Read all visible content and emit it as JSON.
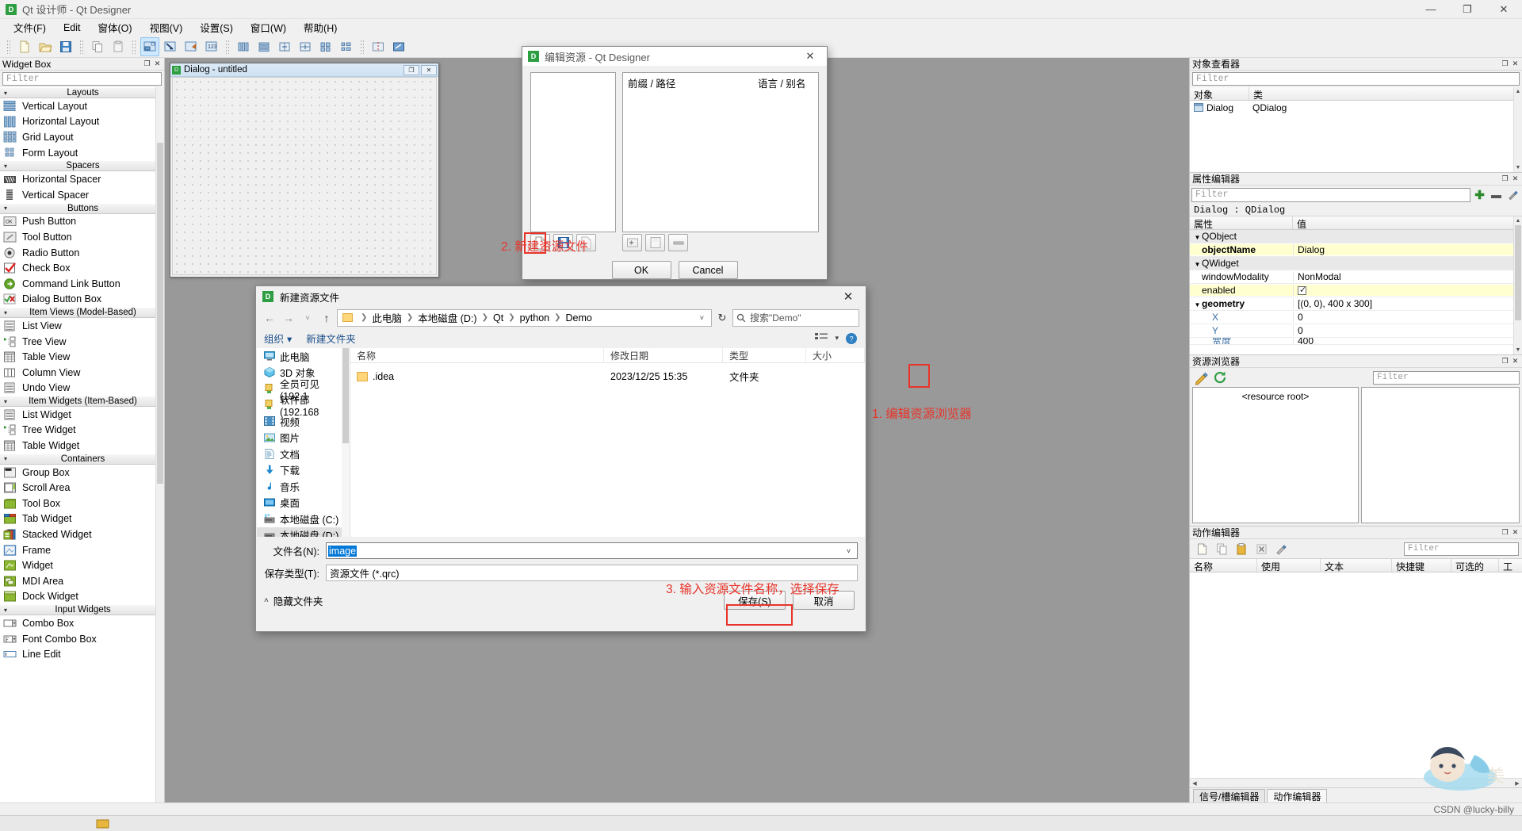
{
  "window": {
    "app_icon": "qt-designer-icon",
    "title": "Qt 设计师 - Qt Designer",
    "minimize": "—",
    "maximize": "❐",
    "close": "✕"
  },
  "menubar": {
    "items": [
      {
        "label": "文件(F)"
      },
      {
        "label": "Edit"
      },
      {
        "label": "窗体(O)"
      },
      {
        "label": "视图(V)"
      },
      {
        "label": "设置(S)"
      },
      {
        "label": "窗口(W)"
      },
      {
        "label": "帮助(H)"
      }
    ]
  },
  "toolbar": {
    "buttons": [
      {
        "name": "new-form-button",
        "icon": "page-icon"
      },
      {
        "name": "open-form-button",
        "icon": "folder-open-icon"
      },
      {
        "name": "save-form-button",
        "icon": "floppy-save-icon"
      },
      {
        "name": "copy-button",
        "icon": "copy-icon"
      },
      {
        "name": "paste-button",
        "icon": "paste-icon"
      },
      {
        "name": "edit-widgets-button",
        "icon": "edit-widgets-icon",
        "active": true
      },
      {
        "name": "edit-signals-slots-button",
        "icon": "signal-slot-icon"
      },
      {
        "name": "edit-buddies-button",
        "icon": "buddies-icon"
      },
      {
        "name": "edit-tab-order-button",
        "icon": "tab-order-icon"
      },
      {
        "name": "layout-horizontal-button",
        "icon": "layout-h-icon"
      },
      {
        "name": "layout-vertical-button",
        "icon": "layout-v-icon"
      },
      {
        "name": "layout-splitter-h-button",
        "icon": "splitter-h-icon"
      },
      {
        "name": "layout-splitter-v-button",
        "icon": "splitter-v-icon"
      },
      {
        "name": "layout-grid-button",
        "icon": "layout-grid-icon"
      },
      {
        "name": "layout-form-button",
        "icon": "layout-form-icon"
      },
      {
        "name": "break-layout-button",
        "icon": "break-layout-icon"
      },
      {
        "name": "adjust-size-button",
        "icon": "adjust-size-icon"
      }
    ]
  },
  "widget_box": {
    "title": "Widget Box",
    "float_btn": "❐",
    "close_btn": "✕",
    "filter_placeholder": "Filter",
    "groups": [
      {
        "label": "Layouts",
        "items": [
          {
            "label": "Vertical Layout",
            "icon": "vertical-layout-icon"
          },
          {
            "label": "Horizontal Layout",
            "icon": "horizontal-layout-icon"
          },
          {
            "label": "Grid Layout",
            "icon": "grid-layout-icon"
          },
          {
            "label": "Form Layout",
            "icon": "form-layout-icon"
          }
        ]
      },
      {
        "label": "Spacers",
        "items": [
          {
            "label": "Horizontal Spacer",
            "icon": "horizontal-spacer-icon"
          },
          {
            "label": "Vertical Spacer",
            "icon": "vertical-spacer-icon"
          }
        ]
      },
      {
        "label": "Buttons",
        "items": [
          {
            "label": "Push Button",
            "icon": "push-button-icon"
          },
          {
            "label": "Tool Button",
            "icon": "tool-button-icon"
          },
          {
            "label": "Radio Button",
            "icon": "radio-button-icon"
          },
          {
            "label": "Check Box",
            "icon": "check-box-icon"
          },
          {
            "label": "Command Link Button",
            "icon": "command-link-icon"
          },
          {
            "label": "Dialog Button Box",
            "icon": "dialog-button-box-icon"
          }
        ]
      },
      {
        "label": "Item Views (Model-Based)",
        "items": [
          {
            "label": "List View",
            "icon": "list-view-icon"
          },
          {
            "label": "Tree View",
            "icon": "tree-view-icon"
          },
          {
            "label": "Table View",
            "icon": "table-view-icon"
          },
          {
            "label": "Column View",
            "icon": "column-view-icon"
          },
          {
            "label": "Undo View",
            "icon": "undo-view-icon"
          }
        ]
      },
      {
        "label": "Item Widgets (Item-Based)",
        "items": [
          {
            "label": "List Widget",
            "icon": "list-widget-icon"
          },
          {
            "label": "Tree Widget",
            "icon": "tree-widget-icon"
          },
          {
            "label": "Table Widget",
            "icon": "table-widget-icon"
          }
        ]
      },
      {
        "label": "Containers",
        "items": [
          {
            "label": "Group Box",
            "icon": "group-box-icon"
          },
          {
            "label": "Scroll Area",
            "icon": "scroll-area-icon"
          },
          {
            "label": "Tool Box",
            "icon": "tool-box-icon"
          },
          {
            "label": "Tab Widget",
            "icon": "tab-widget-icon"
          },
          {
            "label": "Stacked Widget",
            "icon": "stacked-widget-icon"
          },
          {
            "label": "Frame",
            "icon": "frame-icon"
          },
          {
            "label": "Widget",
            "icon": "widget-icon"
          },
          {
            "label": "MDI Area",
            "icon": "mdi-area-icon"
          },
          {
            "label": "Dock Widget",
            "icon": "dock-widget-icon"
          }
        ]
      },
      {
        "label": "Input Widgets",
        "items": [
          {
            "label": "Combo Box",
            "icon": "combo-box-icon"
          },
          {
            "label": "Font Combo Box",
            "icon": "font-combo-box-icon"
          },
          {
            "label": "Line Edit",
            "icon": "line-edit-icon"
          }
        ]
      }
    ]
  },
  "form_window": {
    "icon": "qt-designer-icon",
    "title": "Dialog - untitled",
    "restore_btn": "❐",
    "close_btn": "✕"
  },
  "object_inspector": {
    "title": "对象查看器",
    "float_btn": "❐",
    "close_btn": "✕",
    "filter_placeholder": "Filter",
    "columns": [
      "对象",
      "类"
    ],
    "rows": [
      {
        "object": "Dialog",
        "class": "QDialog",
        "icon": "dialog-icon"
      }
    ]
  },
  "property_editor": {
    "title": "属性编辑器",
    "float_btn": "❐",
    "close_btn": "✕",
    "filter_placeholder": "Filter",
    "add_btn": "✚",
    "remove_btn": "➖",
    "config_btn": "wrench-icon",
    "object_label": "Dialog : QDialog",
    "columns": [
      "属性",
      "值"
    ],
    "rows": [
      {
        "kind": "group",
        "name": "QObject",
        "value": "",
        "twisty": "▼"
      },
      {
        "kind": "prop",
        "name": "objectName",
        "value": "Dialog",
        "bold": true,
        "highlight": true
      },
      {
        "kind": "group",
        "name": "QWidget",
        "value": "",
        "twisty": "▼"
      },
      {
        "kind": "prop",
        "name": "windowModality",
        "value": "NonModal"
      },
      {
        "kind": "prop",
        "name": "enabled",
        "value": "☑",
        "highlight": true
      },
      {
        "kind": "prop",
        "name": "geometry",
        "value": "[(0, 0), 400 x 300]",
        "bold": true,
        "twisty": "▼"
      },
      {
        "kind": "sub",
        "name": "X",
        "value": "0"
      },
      {
        "kind": "sub",
        "name": "Y",
        "value": "0"
      },
      {
        "kind": "sub",
        "name": "宽度",
        "value": "400"
      }
    ]
  },
  "resource_browser": {
    "title": "资源浏览器",
    "float_btn": "❐",
    "close_btn": "✕",
    "edit_btn_icon": "pencil-edit-icon",
    "reload_btn_icon": "reload-icon",
    "filter_placeholder": "Filter",
    "root_label": "<resource root>"
  },
  "action_editor": {
    "title": "动作编辑器",
    "float_btn": "❐",
    "close_btn": "✕",
    "buttons": [
      {
        "name": "new-action-button",
        "icon": "new-page-icon"
      },
      {
        "name": "copy-action-button",
        "icon": "copy-icon"
      },
      {
        "name": "paste-action-button",
        "icon": "paste-icon"
      },
      {
        "name": "delete-action-button",
        "icon": "delete-icon"
      },
      {
        "name": "edit-action-button",
        "icon": "wrench-icon"
      }
    ],
    "filter_placeholder": "Filter",
    "columns": [
      "名称",
      "使用",
      "文本",
      "快捷键",
      "可选的",
      "工"
    ],
    "rows": []
  },
  "bottom_tabs": [
    {
      "label": "信号/槽编辑器",
      "selected": false
    },
    {
      "label": "动作编辑器",
      "selected": true
    }
  ],
  "edit_resource_dialog": {
    "icon": "qt-designer-icon",
    "title": "编辑资源 - Qt Designer",
    "close_btn": "✕",
    "right_headers": [
      "前缀 / 路径",
      "语言 / 别名"
    ],
    "left_toolbar": [
      {
        "name": "new-resource-file-button",
        "icon": "new-page-icon",
        "highlighted": true
      },
      {
        "name": "open-resource-file-button",
        "icon": "floppy-open-icon"
      },
      {
        "name": "remove-resource-file-button",
        "icon": "remove-x-icon"
      }
    ],
    "right_toolbar": [
      {
        "name": "add-prefix-button",
        "icon": "add-folder-icon"
      },
      {
        "name": "add-file-button",
        "icon": "add-file-icon"
      },
      {
        "name": "remove-item-button",
        "icon": "minus-icon"
      }
    ],
    "ok_label": "OK",
    "cancel_label": "Cancel"
  },
  "save_dialog": {
    "icon": "qt-designer-icon",
    "title": "新建资源文件",
    "close_btn": "✕",
    "nav": {
      "back": "←",
      "forward": "→",
      "recent": "˅",
      "up": "↑",
      "refresh": "↻"
    },
    "breadcrumb": [
      "此电脑",
      "本地磁盘 (D:)",
      "Qt",
      "python",
      "Demo"
    ],
    "breadcrumb_dropdown": "˅",
    "search_placeholder": "搜索\"Demo\"",
    "search_icon": "search-icon",
    "toolbar2": {
      "organize": "组织",
      "organize_arrow": "▾",
      "new_folder": "新建文件夹",
      "view_icon": "list-view-icon",
      "view_arrow": "▾",
      "help_icon": "help-icon"
    },
    "tree": [
      {
        "label": "此电脑",
        "icon": "computer-icon"
      },
      {
        "label": "3D 对象",
        "icon": "3d-objects-icon"
      },
      {
        "label": "全员可见 (192.1",
        "icon": "network-folder-icon"
      },
      {
        "label": "软件部 (192.168",
        "icon": "network-folder-icon"
      },
      {
        "label": "视频",
        "icon": "video-icon"
      },
      {
        "label": "图片",
        "icon": "pictures-icon"
      },
      {
        "label": "文档",
        "icon": "documents-icon"
      },
      {
        "label": "下载",
        "icon": "downloads-icon"
      },
      {
        "label": "音乐",
        "icon": "music-icon"
      },
      {
        "label": "桌面",
        "icon": "desktop-icon"
      },
      {
        "label": "本地磁盘 (C:)",
        "icon": "disk-c-icon"
      },
      {
        "label": "本地磁盘 (D:)",
        "icon": "disk-d-icon",
        "selected": true
      }
    ],
    "file_columns": [
      "名称",
      "修改日期",
      "类型",
      "大小"
    ],
    "files": [
      {
        "name": ".idea",
        "modified": "2023/12/25 15:35",
        "type": "文件夹",
        "size": "",
        "icon": "folder-icon"
      }
    ],
    "filename_label": "文件名(N):",
    "filename_value": "image",
    "filename_dropdown": "˅",
    "filetype_label": "保存类型(T):",
    "filetype_value": "资源文件 (*.qrc)",
    "hide_folders_label": "隐藏文件夹",
    "hide_folders_arrow": "˄",
    "save_label": "保存(S)",
    "cancel_label": "取消"
  },
  "annotations": [
    {
      "id": "1",
      "text": "1. 编辑资源浏览器",
      "target": "resource-browser-edit-button"
    },
    {
      "id": "2",
      "text": "2. 新建资源文件",
      "target": "new-resource-file-button"
    },
    {
      "id": "3",
      "text": "3. 输入资源文件名称，选择保存",
      "target": "save-button"
    }
  ],
  "status_bar": {
    "credit": "CSDN @lucky-billy"
  },
  "colors": {
    "annotation_red": "#e8342a",
    "accent_blue": "#0078d7",
    "qt_green": "#2e9e43",
    "highlight_yellow": "#ffffd0",
    "canvas_gray": "#999999"
  }
}
